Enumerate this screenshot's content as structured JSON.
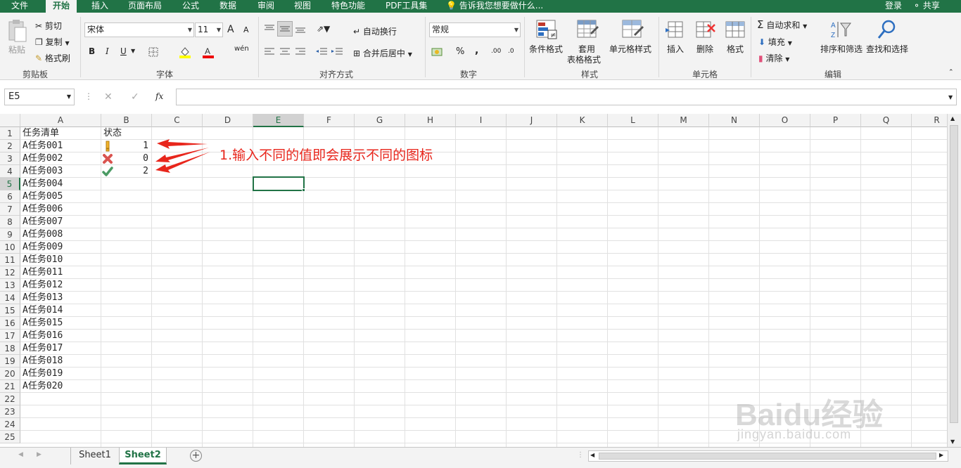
{
  "menu": {
    "items": [
      "文件",
      "开始",
      "插入",
      "页面布局",
      "公式",
      "数据",
      "审阅",
      "视图",
      "特色功能",
      "PDF工具集"
    ],
    "tell_me": "告诉我您想要做什么...",
    "login": "登录",
    "share": "共享"
  },
  "ribbon": {
    "clipboard": {
      "paste": "粘贴",
      "cut": "剪切",
      "copy": "复制",
      "format_painter": "格式刷",
      "label": "剪贴板"
    },
    "font": {
      "name": "宋体",
      "size": "11",
      "bold": "B",
      "italic": "I",
      "underline": "U",
      "grow": "A",
      "shrink": "A",
      "label": "字体"
    },
    "align": {
      "wrap": "自动换行",
      "merge": "合并后居中",
      "label": "对齐方式"
    },
    "number": {
      "format": "常规",
      "percent": "%",
      "comma": ",",
      "inc": ".00",
      "dec": ".0",
      "label": "数字"
    },
    "styles": {
      "cond": "条件格式",
      "table1": "套用",
      "table2": "表格格式",
      "cell": "单元格样式",
      "label": "样式"
    },
    "cells": {
      "insert": "插入",
      "delete": "删除",
      "format": "格式",
      "label": "单元格"
    },
    "editing": {
      "autosum": "自动求和",
      "fill": "填充",
      "clear": "清除",
      "sort": "排序和筛选",
      "find": "查找和选择",
      "label": "编辑"
    }
  },
  "formula_bar": {
    "name_box": "E5",
    "fx": "fx",
    "value": ""
  },
  "columns": [
    "A",
    "B",
    "C",
    "D",
    "E",
    "F",
    "G",
    "H",
    "I",
    "J",
    "K",
    "L",
    "M",
    "N",
    "O",
    "P",
    "Q",
    "R"
  ],
  "rows": [
    "1",
    "2",
    "3",
    "4",
    "5",
    "6",
    "7",
    "8",
    "9",
    "10",
    "11",
    "12",
    "13",
    "14",
    "15",
    "16",
    "17",
    "18",
    "19",
    "20",
    "21",
    "22",
    "23",
    "24",
    "25"
  ],
  "cells": {
    "A": [
      "任务清单",
      "A任务001",
      "A任务002",
      "A任务003",
      "A任务004",
      "A任务005",
      "A任务006",
      "A任务007",
      "A任务008",
      "A任务009",
      "A任务010",
      "A任务011",
      "A任务012",
      "A任务013",
      "A任务014",
      "A任务015",
      "A任务016",
      "A任务017",
      "A任务018",
      "A任务019",
      "A任务020"
    ],
    "B1": "状态",
    "B_values": [
      "1",
      "0",
      "2"
    ],
    "B_icons": [
      "exclamation-icon",
      "cross-icon",
      "check-icon"
    ]
  },
  "annotation": {
    "text": "1.输入不同的值即会展示不同的图标",
    "color": "#e8261c"
  },
  "sheets": {
    "tabs": [
      "Sheet1",
      "Sheet2"
    ],
    "active": "Sheet2"
  },
  "watermark": {
    "main": "Baidu经验",
    "sub": "jingyan.baidu.com"
  },
  "colors": {
    "accent": "#217346"
  }
}
